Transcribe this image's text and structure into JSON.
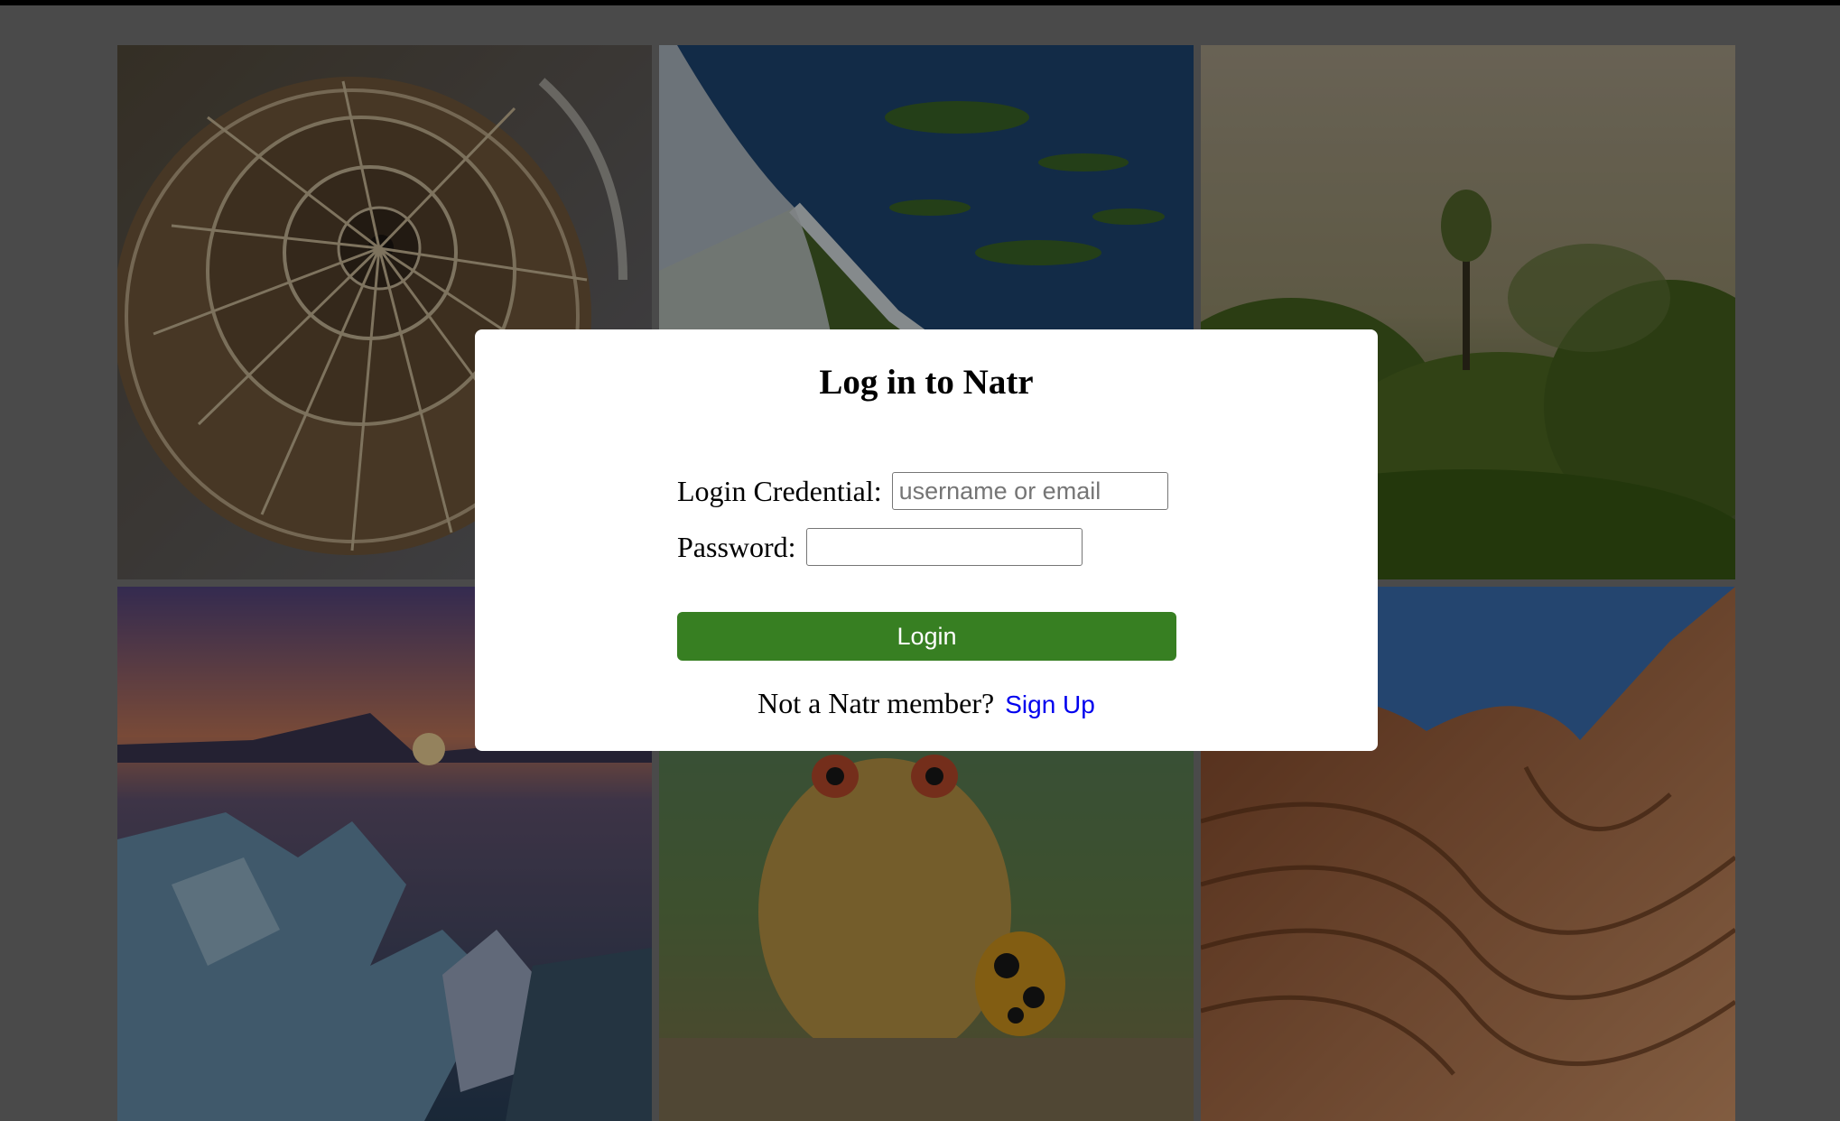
{
  "modal": {
    "title": "Log in to Natr",
    "credential_label": "Login Credential:",
    "credential_placeholder": "username or email",
    "credential_value": "",
    "password_label": "Password:",
    "password_value": "",
    "login_button": "Login",
    "signup_prompt": "Not a Natr member?",
    "signup_link": "Sign Up"
  },
  "gallery": {
    "tiles": [
      {
        "subject": "nautilus shell"
      },
      {
        "subject": "waterfall aerial"
      },
      {
        "subject": "misty forest"
      },
      {
        "subject": "ice at sunset"
      },
      {
        "subject": "frog and ladybug"
      },
      {
        "subject": "sandstone waves"
      }
    ]
  },
  "colors": {
    "overlay": "#4a4a4a",
    "login_button": "#377f22",
    "link": "#0000ee"
  }
}
